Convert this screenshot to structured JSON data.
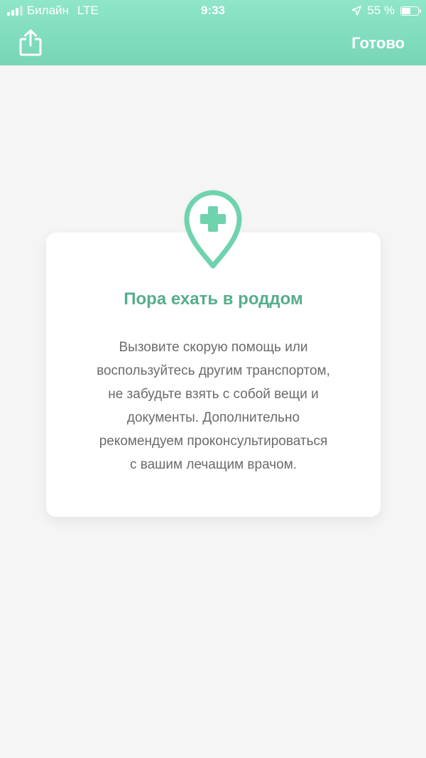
{
  "status_bar": {
    "carrier": "Билайн",
    "network": "LTE",
    "time": "9:33",
    "battery_text": "55 %",
    "battery_level": 0.55
  },
  "nav": {
    "share_icon": "share-icon",
    "done_label": "Готово"
  },
  "card": {
    "icon": "hospital-location-pin-icon",
    "title": "Пора ехать в роддом",
    "text_lines": [
      "Вызовите скорую помощь или",
      "воспользуйтесь другим транспортом,",
      "не забудьте взять с собой вещи и",
      "документы. Дополнительно",
      "рекомендуем проконсультироваться",
      "с вашим лечащим врачом."
    ]
  },
  "colors": {
    "accent": "#57ad8b",
    "header_top": "#8fe6c8",
    "header_bottom": "#79d5b5",
    "pin": "#6fd3ad",
    "background": "#f5f5f5"
  }
}
